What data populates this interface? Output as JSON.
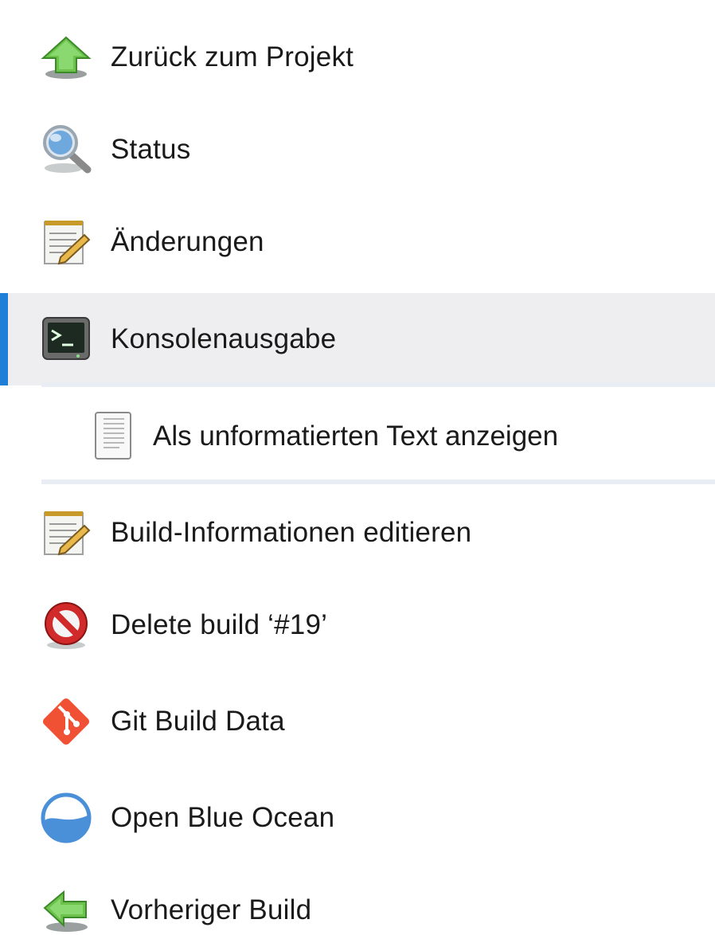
{
  "sidebar": {
    "items": [
      {
        "label": "Zurück zum Projekt",
        "icon": "up-arrow-icon"
      },
      {
        "label": "Status",
        "icon": "magnifier-icon"
      },
      {
        "label": "Änderungen",
        "icon": "notepad-icon"
      },
      {
        "label": "Konsolenausgabe",
        "icon": "terminal-icon",
        "active": true
      },
      {
        "label": "Als unformatierten Text anzeigen",
        "icon": "document-icon",
        "sub": true
      },
      {
        "label": "Build-Informationen editieren",
        "icon": "notepad-icon"
      },
      {
        "label": "Delete build ‘#19’",
        "icon": "no-entry-icon"
      },
      {
        "label": "Git Build Data",
        "icon": "git-icon"
      },
      {
        "label": "Open Blue Ocean",
        "icon": "blue-ocean-icon"
      },
      {
        "label": "Vorheriger Build",
        "icon": "back-arrow-icon"
      }
    ]
  },
  "colors": {
    "active_bar": "#1f7fd6",
    "active_bg": "#eeeef0",
    "sub_border": "#e8eef4",
    "git": "#f05033",
    "blue_ocean": "#4a90d9"
  }
}
